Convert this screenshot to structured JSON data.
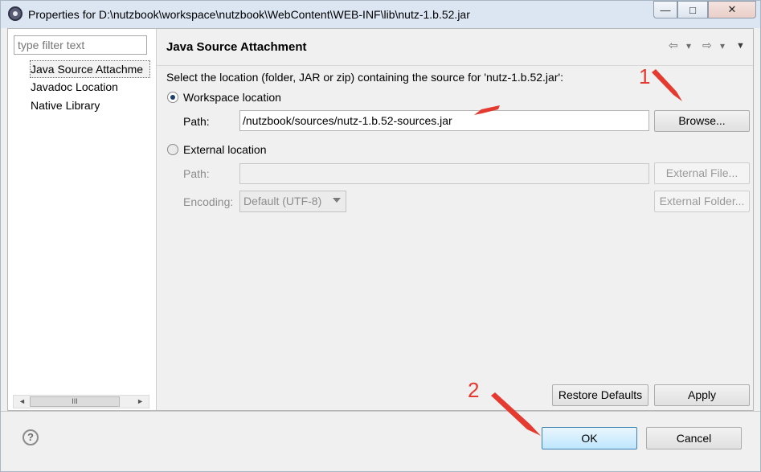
{
  "window": {
    "title": "Properties for D:\\nutzbook\\workspace\\nutzbook\\WebContent\\WEB-INF\\lib\\nutz-1.b.52.jar",
    "min_glyph": "—",
    "max_glyph": "□",
    "close_glyph": "✕"
  },
  "sidebar": {
    "filter_placeholder": "type filter text",
    "items": [
      {
        "label": "Java Source Attachme"
      },
      {
        "label": "Javadoc Location"
      },
      {
        "label": "Native Library"
      }
    ],
    "scroll_left": "◄",
    "scroll_right": "►",
    "scroll_thumb": "III"
  },
  "page": {
    "title": "Java Source Attachment",
    "nav": {
      "back": "⇦",
      "back_menu": "▾",
      "fwd": "⇨",
      "fwd_menu": "▾",
      "menu": "▼"
    },
    "description": "Select the location (folder, JAR or zip) containing the source for 'nutz-1.b.52.jar':",
    "workspace": {
      "label": "Workspace location",
      "path_label": "Path:",
      "path_value": "/nutzbook/sources/nutz-1.b.52-sources.jar",
      "browse": "Browse..."
    },
    "external": {
      "label": "External location",
      "path_label": "Path:",
      "path_value": "",
      "file_button": "External File...",
      "folder_button": "External Folder...",
      "encoding_label": "Encoding:",
      "encoding_value": "Default (UTF-8)"
    },
    "restore_defaults": "Restore Defaults",
    "apply": "Apply"
  },
  "footer": {
    "help": "?",
    "ok": "OK",
    "cancel": "Cancel"
  },
  "annotations": {
    "step1": "1",
    "step2": "2",
    "color": "#e53a2f"
  }
}
